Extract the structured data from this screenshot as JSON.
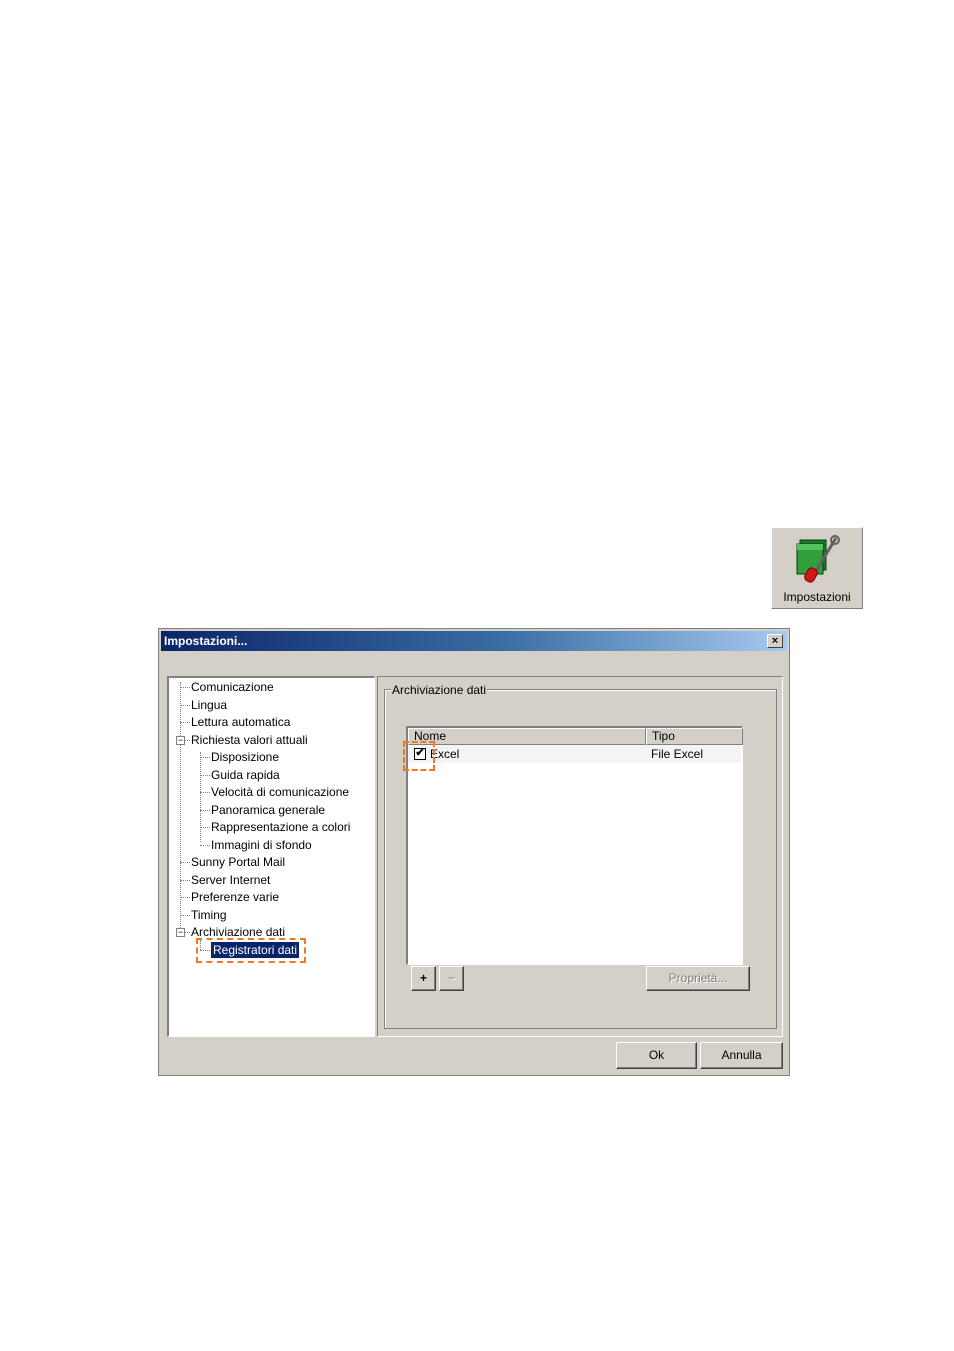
{
  "toolbar": {
    "settings_label": "Impostazioni",
    "settings_icon": "folder-wrench-icon"
  },
  "dialog": {
    "title": "Impostazioni...",
    "close_glyph": "×",
    "tree": {
      "items": [
        {
          "label": "Comunicazione",
          "level": 0
        },
        {
          "label": "Lingua",
          "level": 0
        },
        {
          "label": "Lettura automatica",
          "level": 0
        },
        {
          "label": "Richiesta valori attuali",
          "level": 0,
          "expanded": true
        },
        {
          "label": "Disposizione",
          "level": 1
        },
        {
          "label": "Guida rapida",
          "level": 1
        },
        {
          "label": "Velocità di comunicazione",
          "level": 1
        },
        {
          "label": "Panoramica generale",
          "level": 1
        },
        {
          "label": "Rappresentazione a colori",
          "level": 1
        },
        {
          "label": "Immagini di sfondo",
          "level": 1
        },
        {
          "label": "Sunny Portal Mail",
          "level": 0
        },
        {
          "label": "Server Internet",
          "level": 0
        },
        {
          "label": "Preferenze varie",
          "level": 0
        },
        {
          "label": "Timing",
          "level": 0
        },
        {
          "label": "Archiviazione dati",
          "level": 0,
          "expanded": true
        },
        {
          "label": "Registratori dati",
          "level": 1,
          "selected": true
        }
      ]
    },
    "group_title": "Archiviazione dati",
    "list": {
      "columns": [
        "Nome",
        "Tipo"
      ],
      "rows": [
        {
          "checked": true,
          "check_glyph": "✔",
          "nome": "Excel",
          "tipo": "File Excel"
        }
      ]
    },
    "buttons": {
      "add": "+",
      "remove": "−",
      "properties": "Proprietà...",
      "ok": "Ok",
      "cancel": "Annulla"
    },
    "highlight_color": "#f07820"
  }
}
